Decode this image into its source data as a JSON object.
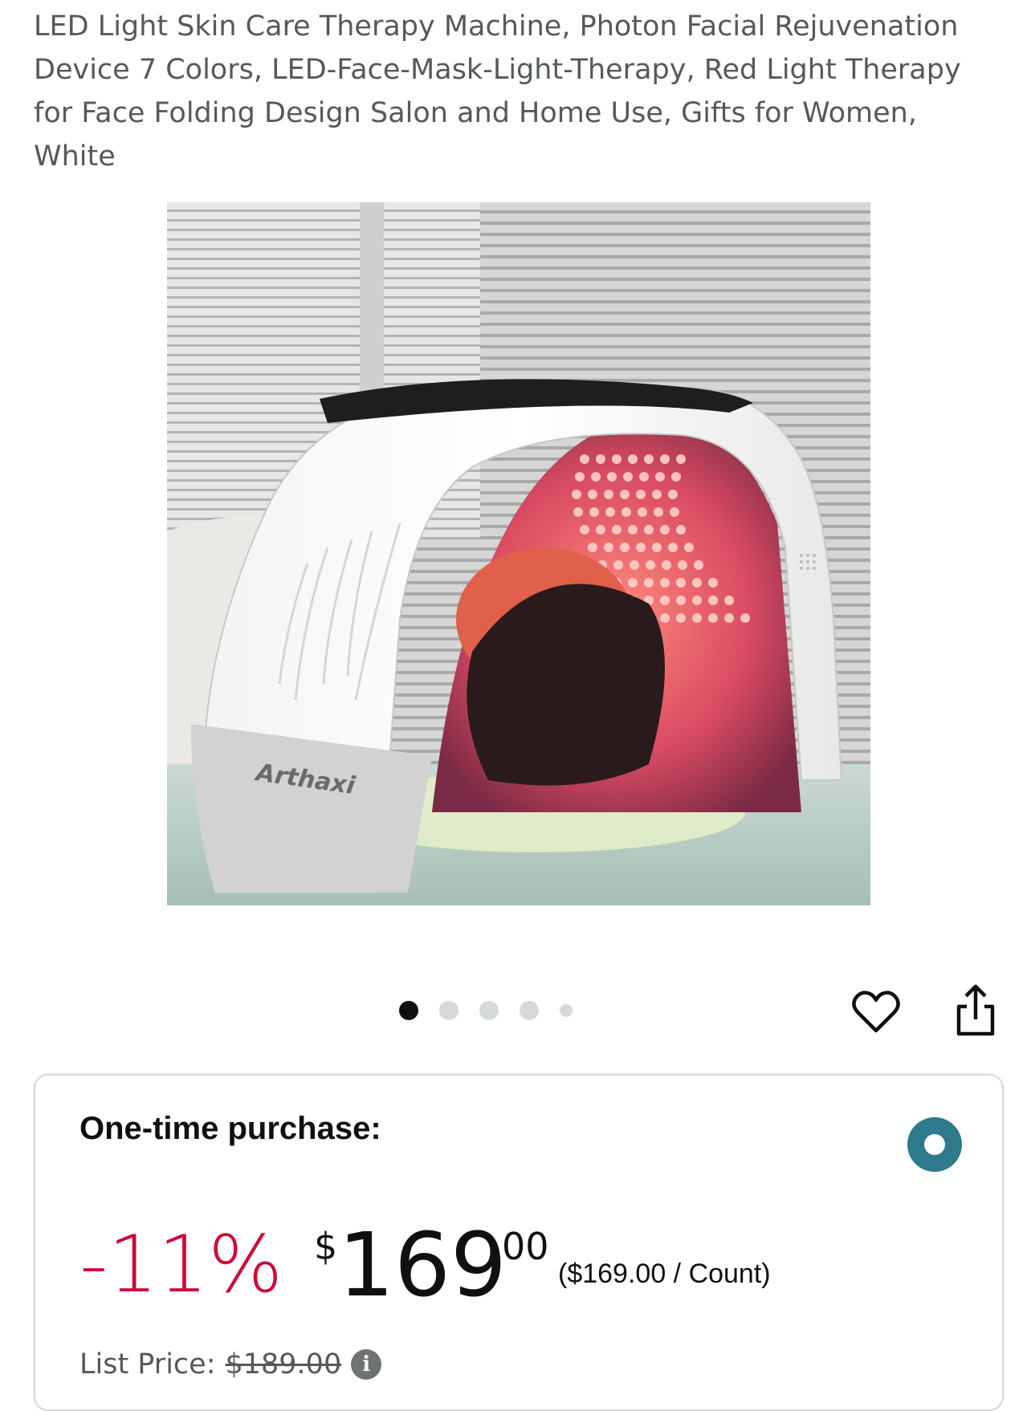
{
  "product": {
    "title": "LED Light Skin Care Therapy Machine, Photon Facial Rejuvenation Device 7 Colors, LED-Face-Mask-Light-Therapy, Red Light Therapy for Face Folding Design Salon and Home Use, Gifts for Women, White",
    "brand_mark": "Arthaxi"
  },
  "gallery": {
    "dots": 5,
    "active_index": 0
  },
  "icons": {
    "favorite": "heart-icon",
    "share": "share-icon",
    "info": "info-icon"
  },
  "purchase": {
    "label": "One-time purchase:",
    "selected": true,
    "discount": "-11%",
    "currency_symbol": "$",
    "price_whole": "169",
    "price_fraction": "00",
    "unit_price": "($169.00 / Count)",
    "list_price_label": "List Price:",
    "list_price": "$189.00"
  },
  "colors": {
    "discount_red": "#cc0c39",
    "radio_teal": "#2e7a8c",
    "muted_text": "#565959"
  }
}
